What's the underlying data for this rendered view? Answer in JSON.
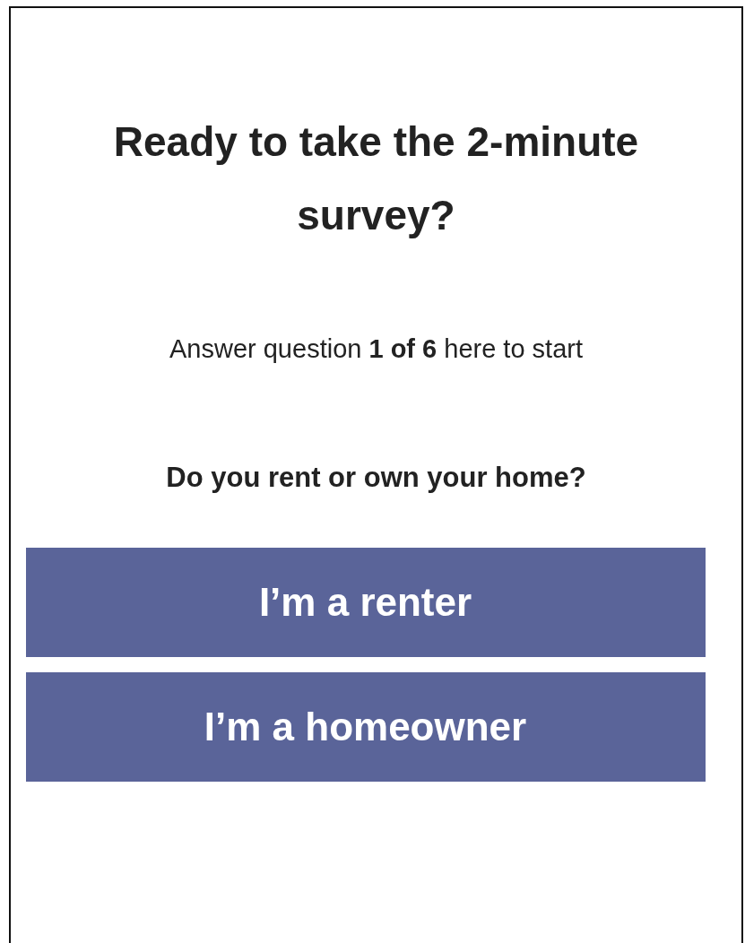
{
  "title": "Ready to take the 2-minute survey?",
  "subtitle": "Answer question **1 of 6** here to start",
  "question": "Do you rent or own your home?",
  "answers": [
    {
      "label": "I’m a renter"
    },
    {
      "label": "I’m a homeowner"
    }
  ]
}
